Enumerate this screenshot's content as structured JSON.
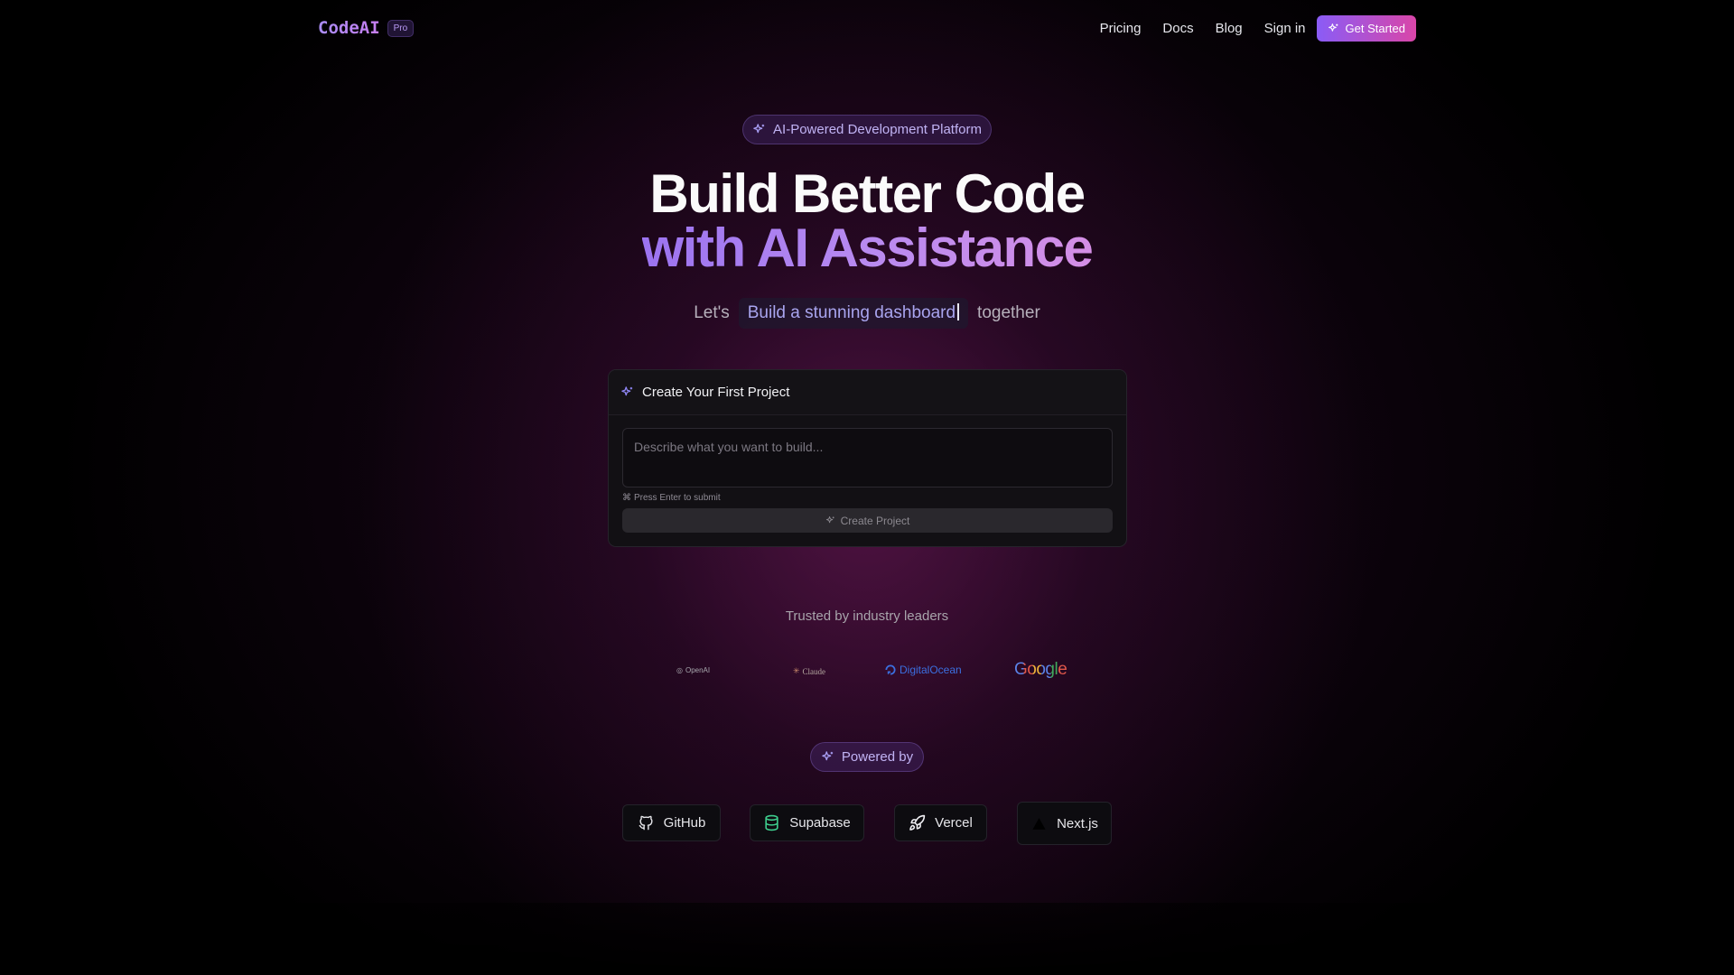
{
  "nav": {
    "brand": "CodeAI",
    "badge": "Pro",
    "links": [
      "Pricing",
      "Docs",
      "Blog",
      "Sign in"
    ],
    "cta": "Get Started"
  },
  "hero": {
    "pill": "AI-Powered Development Platform",
    "line1": "Build Better Code",
    "line2": "with AI Assistance",
    "tagline_prefix": "Let's",
    "tagline_typed": "Build a stunning dashboard",
    "tagline_suffix": "together"
  },
  "card": {
    "title": "Create Your First Project",
    "placeholder": "Describe what you want to build...",
    "hint": "Press Enter to submit",
    "button": "Create Project"
  },
  "trusted": {
    "label": "Trusted by industry leaders",
    "logos": [
      "OpenAI",
      "Claude",
      "DigitalOcean",
      "Google"
    ]
  },
  "powered": {
    "label": "Powered by",
    "items": [
      "GitHub",
      "Supabase",
      "Vercel",
      "Next.js"
    ]
  },
  "icons": {
    "sparkle": "sparkles-icon",
    "github": "github-icon",
    "supabase": "database-icon",
    "vercel": "rocket-icon",
    "next": "triangle-icon"
  },
  "colors": {
    "accent_start": "#8a5cf6",
    "accent_end": "#d946a8",
    "background": "#000000"
  }
}
